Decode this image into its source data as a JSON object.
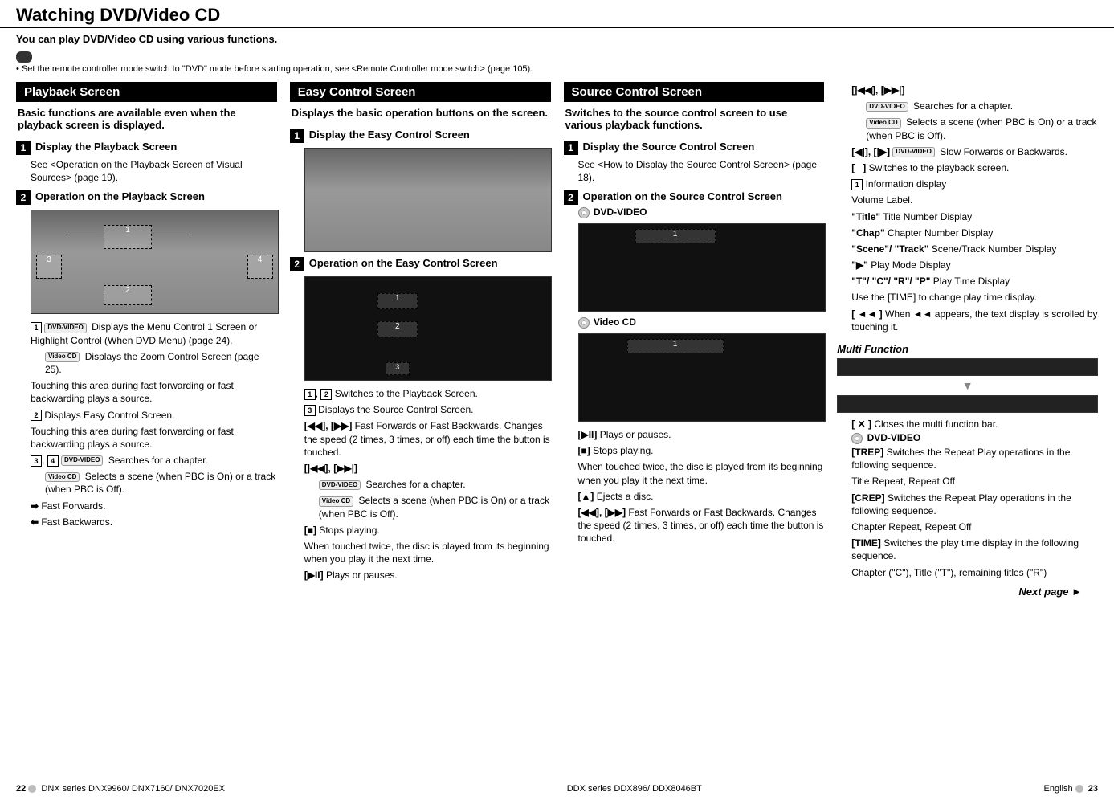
{
  "page": {
    "title": "Watching DVD/Video CD",
    "intro": "You can play DVD/Video CD using various functions.",
    "note": "Set the remote controller mode switch to \"DVD\" mode before starting operation, see <Remote Controller mode switch> (page 105)."
  },
  "col1": {
    "header": "Playback Screen",
    "subhead": "Basic functions are available even when the playback screen is displayed.",
    "step1_title": "Display the Playback Screen",
    "step1_body": "See <Operation on the Playback Screen of Visual Sources> (page 19).",
    "step2_title": "Operation on the Playback Screen",
    "i1_dvd": "Displays the Menu Control 1 Screen or Highlight Control (When DVD Menu) (page 24).",
    "i1_vcd": "Displays the Zoom Control Screen (page 25).",
    "i1_touch": "Touching this area during fast forwarding or fast backwarding plays a source.",
    "i2": "Displays Easy Control Screen.",
    "i2_touch": "Touching this area during fast forwarding or fast backwarding plays a source.",
    "i34_dvd": "Searches for a chapter.",
    "i34_vcd": "Selects a scene (when PBC is On) or a track (when PBC is Off).",
    "ff": "Fast Forwards.",
    "fb": "Fast Backwards."
  },
  "col2": {
    "header": "Easy Control Screen",
    "subhead": "Displays the basic operation buttons on the screen.",
    "step1_title": "Display the Easy Control Screen",
    "step2_title": "Operation on the Easy Control Screen",
    "i12": "Switches to the Playback Screen.",
    "i3": "Displays the Source Control Screen.",
    "ffrw": "Fast Forwards or Fast Backwards. Changes the speed (2 times, 3 times, or off) each time the button is touched.",
    "skip_dvd": "Searches for a chapter.",
    "skip_vcd": "Selects a scene (when PBC is On) or a track (when PBC is Off).",
    "stop": "Stops playing.",
    "stop_detail": "When touched twice, the disc is played from its beginning when you play it the next time.",
    "playpause": "Plays or pauses."
  },
  "col3": {
    "header": "Source Control Screen",
    "subhead": "Switches to the source control screen to use various playback functions.",
    "step1_title": "Display the Source Control Screen",
    "step1_body": "See <How to Display the Source Control Screen> (page 18).",
    "step2_title": "Operation on the Source Control Screen",
    "dvd_label": "DVD-VIDEO",
    "vcd_label": "Video CD",
    "playpause": "Plays or pauses.",
    "stop": "Stops playing.",
    "stop_detail": "When touched twice, the disc is played from its beginning when you play it the next time.",
    "eject": "Ejects a disc.",
    "ffrw": "Fast Forwards or Fast Backwards. Changes the speed (2 times, 3 times, or off) each time the button is touched."
  },
  "col4": {
    "skip_dvd": "Searches for a chapter.",
    "skip_vcd": "Selects a scene (when PBC is On) or a track (when PBC is Off).",
    "slow": "Slow Forwards or Backwards.",
    "switch_playback": "Switches to the playback screen.",
    "info": "Information display",
    "vol": "Volume Label.",
    "title_lbl": "Title Number Display",
    "chap_lbl": "Chapter Number Display",
    "scene_lbl": "Scene/Track Number Display",
    "playmode_lbl": "Play Mode Display",
    "time_lbl": "Play Time Display",
    "time_detail": "Use the [TIME] to change play time display.",
    "scroll": "When ◄◄ appears, the text display is scrolled by touching it.",
    "multi_title": "Multi Function",
    "close_multi": "Closes the multi function bar.",
    "dvd_label": "DVD-VIDEO",
    "trep": "Switches the Repeat Play operations in the following sequence.",
    "trep_seq": "Title Repeat, Repeat Off",
    "crep": "Switches the Repeat Play operations in the following sequence.",
    "crep_seq": "Chapter Repeat, Repeat Off",
    "time": "Switches the play time display in the following sequence.",
    "time_seq": "Chapter (\"C\"), Title (\"T\"), remaining titles (\"R\")",
    "next_page": "Next page ►"
  },
  "footer": {
    "left_page": "22",
    "left": "DNX series   DNX9960/ DNX7160/ DNX7020EX",
    "mid": "DDX series   DDX896/ DDX8046BT",
    "right_lang": "English",
    "right_page": "23"
  }
}
